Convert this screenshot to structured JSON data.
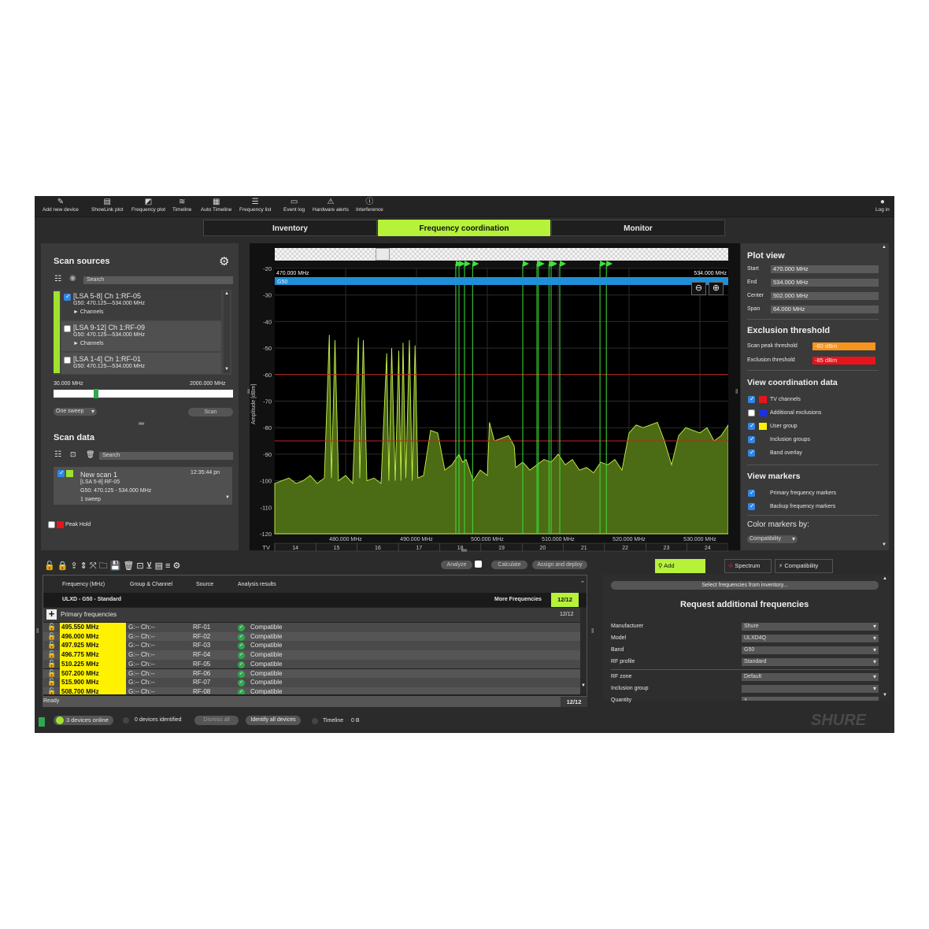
{
  "toolbar": {
    "items": [
      {
        "label": "Add new device",
        "icon": "add-device-icon"
      },
      {
        "label": "ShowLink plot",
        "icon": "showlink-plot-icon"
      },
      {
        "label": "Frequency plot",
        "icon": "frequency-plot-icon"
      },
      {
        "label": "Timeline",
        "icon": "timeline-icon"
      },
      {
        "label": "Auto Timeline",
        "icon": "auto-timeline-icon"
      },
      {
        "label": "Frequency list",
        "icon": "frequency-list-icon"
      },
      {
        "label": "Event log",
        "icon": "event-log-icon"
      },
      {
        "label": "Hardware alerts",
        "icon": "warning-icon"
      },
      {
        "label": "Interference",
        "icon": "interference-icon"
      }
    ],
    "login_label": "Log in"
  },
  "tabs": [
    {
      "label": "Inventory",
      "active": false
    },
    {
      "label": "Frequency coordination",
      "active": true
    },
    {
      "label": "Monitor",
      "active": false
    }
  ],
  "scan_sources": {
    "title": "Scan sources",
    "search_placeholder": "Search",
    "items": [
      {
        "title": "[LSA 5-8]  Ch 1:RF-05",
        "range": "G50: 470.125—534.000 MHz",
        "sub": "► Channels",
        "checked": true
      },
      {
        "title": "[LSA 9-12]  Ch 1:RF-09",
        "range": "G50: 470.125—534.000 MHz",
        "sub": "► Channels",
        "checked": false
      },
      {
        "title": "[LSA 1-4]  Ch 1:RF-01",
        "range": "G50: 470.125—534.000 MHz",
        "sub": "",
        "checked": false
      }
    ],
    "range_start": "30.000 MHz",
    "range_end": "2000.000 MHz",
    "sweep_select": "One sweep",
    "scan_button": "Scan"
  },
  "scan_data": {
    "title": "Scan data",
    "search_placeholder": "Search",
    "item": {
      "name": "New scan 1",
      "time": "12:35:44 pn",
      "source": "[LSA 5-8] RF-05",
      "range": "G50: 470.125 - 534.000 MHz",
      "sweeps": "1 sweep"
    },
    "peak_hold_label": "Peak Hold"
  },
  "chart_data": {
    "type": "area",
    "ylabel": "Amplitude [dBm]",
    "ylim": [
      -120,
      -20
    ],
    "xlim": [
      470.0,
      534.0
    ],
    "y_ticks": [
      "-20",
      "-30",
      "-40",
      "-50",
      "-60",
      "-70",
      "-80",
      "-90",
      "-100",
      "-110",
      "-120"
    ],
    "x_ticks": [
      {
        "v": 480,
        "label": "480.000 MHz"
      },
      {
        "v": 490,
        "label": "490.000 MHz"
      },
      {
        "v": 500,
        "label": "500.000 MHz"
      },
      {
        "v": 510,
        "label": "510.000 MHz"
      },
      {
        "v": 520,
        "label": "520.000 MHz"
      },
      {
        "v": 530,
        "label": "530.000 MHz"
      }
    ],
    "tv_label": "TV",
    "tv_channels": [
      "14",
      "15",
      "16",
      "17",
      "18",
      "19",
      "20",
      "21",
      "22",
      "23",
      "24"
    ],
    "range_left_label": "470.000 MHz",
    "range_right_label": "534.000 MHz",
    "band_label": "G50",
    "thresholds": [
      -60,
      -85
    ],
    "frequency_markers": [
      495.55,
      496.0,
      497.925,
      496.775,
      510.225,
      507.2,
      515.9,
      508.7,
      507.0,
      505.0,
      509.0,
      516.8
    ],
    "x": [
      470.0,
      471.0,
      472.0,
      473.0,
      474.0,
      475.0,
      476.0,
      477.0,
      477.7,
      478.0,
      478.5,
      479.0,
      480.0,
      481.0,
      481.8,
      482.0,
      482.5,
      483.0,
      484.0,
      485.0,
      485.8,
      486.1,
      486.5,
      487.0,
      487.5,
      487.8,
      488.1,
      488.5,
      489.0,
      489.4,
      489.8,
      490.2,
      491.0,
      492.0,
      493.0,
      494.0,
      495.0,
      496.0,
      496.5,
      497.0,
      498.0,
      499.0,
      500.0,
      500.3,
      501.0,
      502.0,
      503.0,
      503.8,
      504.0,
      505.0,
      506.0,
      507.0,
      508.0,
      509.0,
      510.0,
      511.0,
      512.0,
      513.0,
      514.0,
      515.0,
      516.0,
      517.0,
      518.0,
      519.0,
      520.0,
      521.0,
      522.0,
      523.0,
      524.0,
      525.0,
      526.0,
      527.0,
      528.0,
      529.0,
      530.0,
      531.0,
      532.0,
      533.0,
      534.0
    ],
    "y": [
      -101,
      -100,
      -99,
      -101,
      -100,
      -98,
      -101,
      -99,
      -45,
      -99,
      -47,
      -100,
      -98,
      -101,
      -46,
      -99,
      -47,
      -100,
      -99,
      -101,
      -52,
      -100,
      -50,
      -100,
      -51,
      -100,
      -48,
      -99,
      -47,
      -100,
      -49,
      -99,
      -98,
      -81,
      -82,
      -96,
      -94,
      -90,
      -93,
      -92,
      -100,
      -96,
      -98,
      -78,
      -85,
      -84,
      -83,
      -87,
      -95,
      -93,
      -96,
      -94,
      -92,
      -93,
      -90,
      -94,
      -92,
      -96,
      -95,
      -97,
      -93,
      -94,
      -92,
      -96,
      -82,
      -79,
      -80,
      -79,
      -78,
      -85,
      -94,
      -83,
      -80,
      -81,
      -82,
      -80,
      -85,
      -83,
      -79
    ]
  },
  "plot_view": {
    "title": "Plot view",
    "rows": [
      {
        "label": "Start",
        "value": "470.000 MHz"
      },
      {
        "label": "End",
        "value": "534.000 MHz"
      },
      {
        "label": "Center",
        "value": "502.000 MHz"
      },
      {
        "label": "Span",
        "value": "64.000 MHz"
      }
    ]
  },
  "exclusion": {
    "title": "Exclusion threshold",
    "scan_peak_label": "Scan peak threshold",
    "scan_peak_value": "-60 dBm",
    "excl_label": "Exclusion threshold",
    "excl_value": "-85 dBm",
    "scan_peak_color": "#f7941d",
    "excl_color": "#e8141c"
  },
  "coordination_data": {
    "title": "View coordination data",
    "items": [
      {
        "label": "TV channels",
        "checked": true,
        "color": "#e8141c"
      },
      {
        "label": "Additional exclusions",
        "checked": false,
        "color": "#1a2fe8"
      },
      {
        "label": "User group",
        "checked": true,
        "color": "#fff200"
      },
      {
        "label": "Inclusion groups",
        "checked": true,
        "color": ""
      },
      {
        "label": "Band overlay",
        "checked": true,
        "color": ""
      }
    ]
  },
  "view_markers": {
    "title": "View markers",
    "items": [
      {
        "label": "Primary frequency markers",
        "checked": true
      },
      {
        "label": "Backup frequency markers",
        "checked": true
      }
    ],
    "color_by_label": "Color markers by:",
    "color_by_value": "Compatibility"
  },
  "bottom_toolbar": {
    "analyze": "Analyze",
    "calculate": "Calculate",
    "assign": "Assign and deploy"
  },
  "freq_table": {
    "headers": [
      "Frequency (MHz)",
      "Group & Channel",
      "Source",
      "Analysis results"
    ],
    "group_label": "ULXD - G50 - Standard",
    "more_label": "More Frequencies",
    "count": "12/12",
    "primary_label": "Primary frequencies",
    "primary_count": "12/12",
    "rows": [
      {
        "freq": "495.550 MHz",
        "gc": "G:-- Ch:--",
        "src": "RF-01",
        "result": "Compatible"
      },
      {
        "freq": "496.000 MHz",
        "gc": "G:-- Ch:--",
        "src": "RF-02",
        "result": "Compatible"
      },
      {
        "freq": "497.925 MHz",
        "gc": "G:-- Ch:--",
        "src": "RF-03",
        "result": "Compatible"
      },
      {
        "freq": "496.775 MHz",
        "gc": "G:-- Ch:--",
        "src": "RF-04",
        "result": "Compatible"
      },
      {
        "freq": "510.225 MHz",
        "gc": "G:-- Ch:--",
        "src": "RF-05",
        "result": "Compatible"
      },
      {
        "freq": "507.200 MHz",
        "gc": "G:-- Ch:--",
        "src": "RF-06",
        "result": "Compatible"
      },
      {
        "freq": "515.900 MHz",
        "gc": "G:-- Ch:--",
        "src": "RF-07",
        "result": "Compatible"
      },
      {
        "freq": "508.700 MHz",
        "gc": "G:-- Ch:--",
        "src": "RF-08",
        "result": "Compatible"
      }
    ],
    "status": "Ready",
    "status_count": "12/12"
  },
  "right_tabs": {
    "items": [
      {
        "label": "Add frequencies",
        "active": true
      },
      {
        "label": "Spectrum",
        "active": false
      },
      {
        "label": "Compatibility",
        "active": false
      }
    ],
    "select_button": "Select frequencies from inventory...",
    "request_title": "Request additional frequencies",
    "form": [
      {
        "label": "Manufacturer",
        "value": "Shure"
      },
      {
        "label": "Model",
        "value": "ULXD4Q"
      },
      {
        "label": "Band",
        "value": "G50"
      },
      {
        "label": "RF profile",
        "value": "Standard"
      },
      {
        "label": "RF zone",
        "value": "Default"
      },
      {
        "label": "Inclusion group",
        "value": ""
      }
    ],
    "quantity_label": "Quantity",
    "quantity_value": "1"
  },
  "status_bar": {
    "online": "3 devices online",
    "identified": "0 devices identified",
    "dismiss": "Dismiss all",
    "identify": "Identify all devices",
    "timeline": "Timeline",
    "timeline_size": "0 B",
    "brand": "SHURE"
  }
}
